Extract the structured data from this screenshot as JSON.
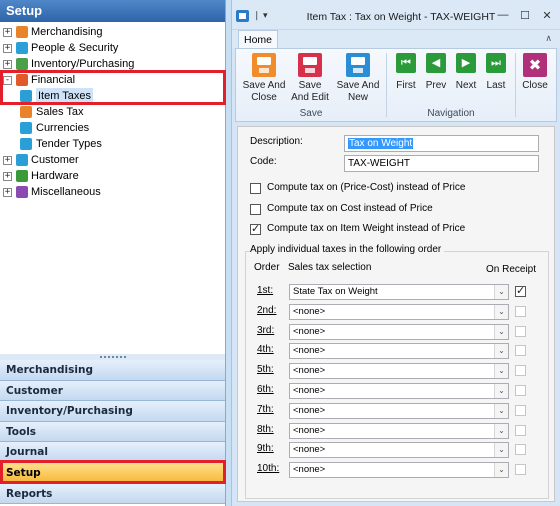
{
  "left_pane": {
    "title": "Setup",
    "tree": [
      {
        "label": "Merchandising",
        "expander": "+",
        "icon": "merchandising-icon",
        "color": "#e8832a"
      },
      {
        "label": "People & Security",
        "expander": "+",
        "icon": "people-security-icon",
        "color": "#2aa0d8"
      },
      {
        "label": "Inventory/Purchasing",
        "expander": "+",
        "icon": "inventory-purchasing-icon",
        "color": "#4aa04a"
      },
      {
        "label": "Financial",
        "expander": "-",
        "icon": "financial-icon",
        "color": "#e05a2a"
      },
      {
        "label": "Item Taxes",
        "icon": "item-taxes-icon",
        "color": "#2a9ed6",
        "child": true
      },
      {
        "label": "Sales Tax",
        "icon": "sales-tax-icon",
        "color": "#e8832a",
        "child": true
      },
      {
        "label": "Currencies",
        "icon": "currencies-icon",
        "color": "#2aa0d8",
        "child": true
      },
      {
        "label": "Tender Types",
        "icon": "tender-types-icon",
        "color": "#2a9ed6",
        "child": true
      },
      {
        "label": "Customer",
        "expander": "+",
        "icon": "customer-icon",
        "color": "#2a9ed6"
      },
      {
        "label": "Hardware",
        "expander": "+",
        "icon": "hardware-icon",
        "color": "#3a9a3a"
      },
      {
        "label": "Miscellaneous",
        "expander": "+",
        "icon": "miscellaneous-icon",
        "color": "#8a4ab0"
      }
    ],
    "nav_buttons": [
      "Merchandising",
      "Customer",
      "Inventory/Purchasing",
      "Tools",
      "Journal",
      "Setup",
      "Reports"
    ],
    "active_nav": "Setup"
  },
  "window": {
    "title": "Item Tax : Tax on Weight - TAX-WEIGHT",
    "quick_access": "❘ ▾",
    "min": "—",
    "max": "☐",
    "close": "✕"
  },
  "ribbon": {
    "tab": "Home",
    "collapse": "∧",
    "save_group": {
      "label": "Save",
      "buttons": [
        {
          "label": "Save And Close",
          "l1": "Save And",
          "l2": "Close",
          "icon": "save-close-icon",
          "color": "#f08c2a"
        },
        {
          "label": "Save And Edit",
          "l1": "Save",
          "l2": "And Edit",
          "icon": "save-edit-icon",
          "color": "#d6304a"
        },
        {
          "label": "Save And New",
          "l1": "Save And",
          "l2": "New",
          "icon": "save-new-icon",
          "color": "#2a8ed6"
        }
      ]
    },
    "navigation_group": {
      "label": "Navigation",
      "buttons": [
        {
          "label": "First",
          "icon": "first-icon",
          "glyph": "⏮",
          "color": "#2a9a3a"
        },
        {
          "label": "Prev",
          "icon": "prev-icon",
          "glyph": "◀",
          "color": "#2a9a3a"
        },
        {
          "label": "Next",
          "icon": "next-icon",
          "glyph": "▶",
          "color": "#2a9a3a"
        },
        {
          "label": "Last",
          "icon": "last-icon",
          "glyph": "⏭",
          "color": "#2a9a3a"
        }
      ]
    },
    "close": {
      "label": "Close",
      "icon": "close-x-icon",
      "glyph": "✖",
      "color": "#b0307a"
    }
  },
  "form": {
    "description_label": "Description:",
    "description_value": "Tax on Weight",
    "code_label": "Code:",
    "code_value": "TAX-WEIGHT",
    "checkboxes": [
      {
        "label": "Compute tax on (Price-Cost) instead of Price",
        "checked": false
      },
      {
        "label": "Compute tax on Cost instead of Price",
        "checked": false
      },
      {
        "label": "Compute tax on Item Weight instead of Price",
        "checked": true
      }
    ],
    "group_title": "Apply individual taxes in the following order",
    "col_order": "Order",
    "col_selection": "Sales tax selection",
    "col_onreceipt": "On Receipt",
    "tax_rows": [
      {
        "order": "1st:",
        "value": "State Tax on Weight",
        "on_receipt": true
      },
      {
        "order": "2nd:",
        "value": "<none>",
        "on_receipt": false
      },
      {
        "order": "3rd:",
        "value": "<none>",
        "on_receipt": false
      },
      {
        "order": "4th:",
        "value": "<none>",
        "on_receipt": false
      },
      {
        "order": "5th:",
        "value": "<none>",
        "on_receipt": false
      },
      {
        "order": "6th:",
        "value": "<none>",
        "on_receipt": false
      },
      {
        "order": "7th:",
        "value": "<none>",
        "on_receipt": false
      },
      {
        "order": "8th:",
        "value": "<none>",
        "on_receipt": false
      },
      {
        "order": "9th:",
        "value": "<none>",
        "on_receipt": false
      },
      {
        "order": "10th:",
        "value": "<none>",
        "on_receipt": false
      }
    ]
  },
  "colors": {
    "highlight": "#e3202a",
    "active_nav": "#f7b636",
    "header": "#2e64a8"
  }
}
